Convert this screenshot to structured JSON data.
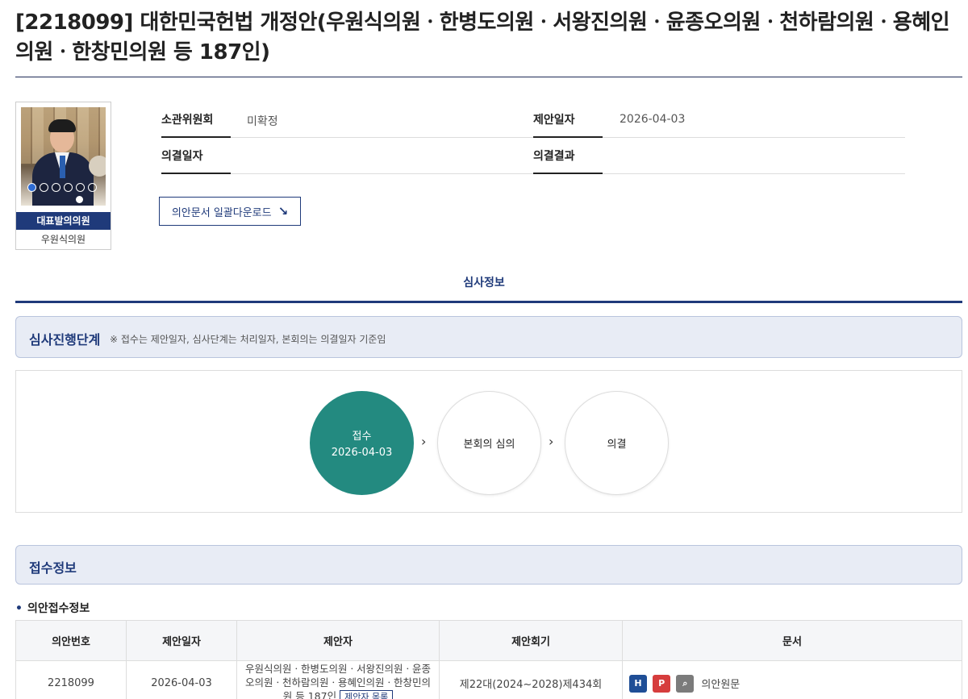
{
  "bill": {
    "title": "[2218099] 대한민국헌법 개정안(우원식의원ㆍ한병도의원ㆍ서왕진의원ㆍ윤종오의원ㆍ천하람의원ㆍ용혜인의원ㆍ한창민의원 등 187인)"
  },
  "representative": {
    "badge": "대표발의의원",
    "name": "우원식의원"
  },
  "info": {
    "committee_label": "소관위원회",
    "committee_value": "미확정",
    "proposal_date_label": "제안일자",
    "proposal_date_value": "2026-04-03",
    "resolution_date_label": "의결일자",
    "resolution_date_value": "",
    "resolution_result_label": "의결결과",
    "resolution_result_value": ""
  },
  "download": {
    "label": "의안문서 일괄다운로드",
    "icon": "arrow-down-right-icon"
  },
  "tabs": {
    "review_info": "심사정보"
  },
  "progress": {
    "title": "심사진행단계",
    "note": "※ 접수는 제안일자, 심사단계는 처리일자, 본회의는 의결일자 기준임",
    "stages": [
      {
        "label": "접수",
        "date": "2026-04-03",
        "status": "done"
      },
      {
        "label": "본회의 심의",
        "date": "",
        "status": "pending"
      },
      {
        "label": "의결",
        "date": "",
        "status": "pending"
      }
    ],
    "done_color": "#238a80"
  },
  "reception": {
    "title": "접수정보",
    "subheading": "의안접수정보",
    "columns": [
      "의안번호",
      "제안일자",
      "제안자",
      "제안회기",
      "문서"
    ],
    "row": {
      "bill_no": "2218099",
      "proposal_date": "2026-04-03",
      "proposers": "우원식의원ㆍ한병도의원ㆍ서왕진의원ㆍ윤종오의원ㆍ천하람의원ㆍ용혜인의원ㆍ한창민의원 등 187인",
      "proposer_list_button": "제안자 목록",
      "session": "제22대(2024~2028)제434회",
      "doc_label": "의안원문",
      "doc_icons": [
        "hwp-icon",
        "pdf-icon",
        "view-icon"
      ]
    }
  },
  "colors": {
    "brand": "#1f3a7a",
    "section_bg": "#e8ecf5"
  }
}
